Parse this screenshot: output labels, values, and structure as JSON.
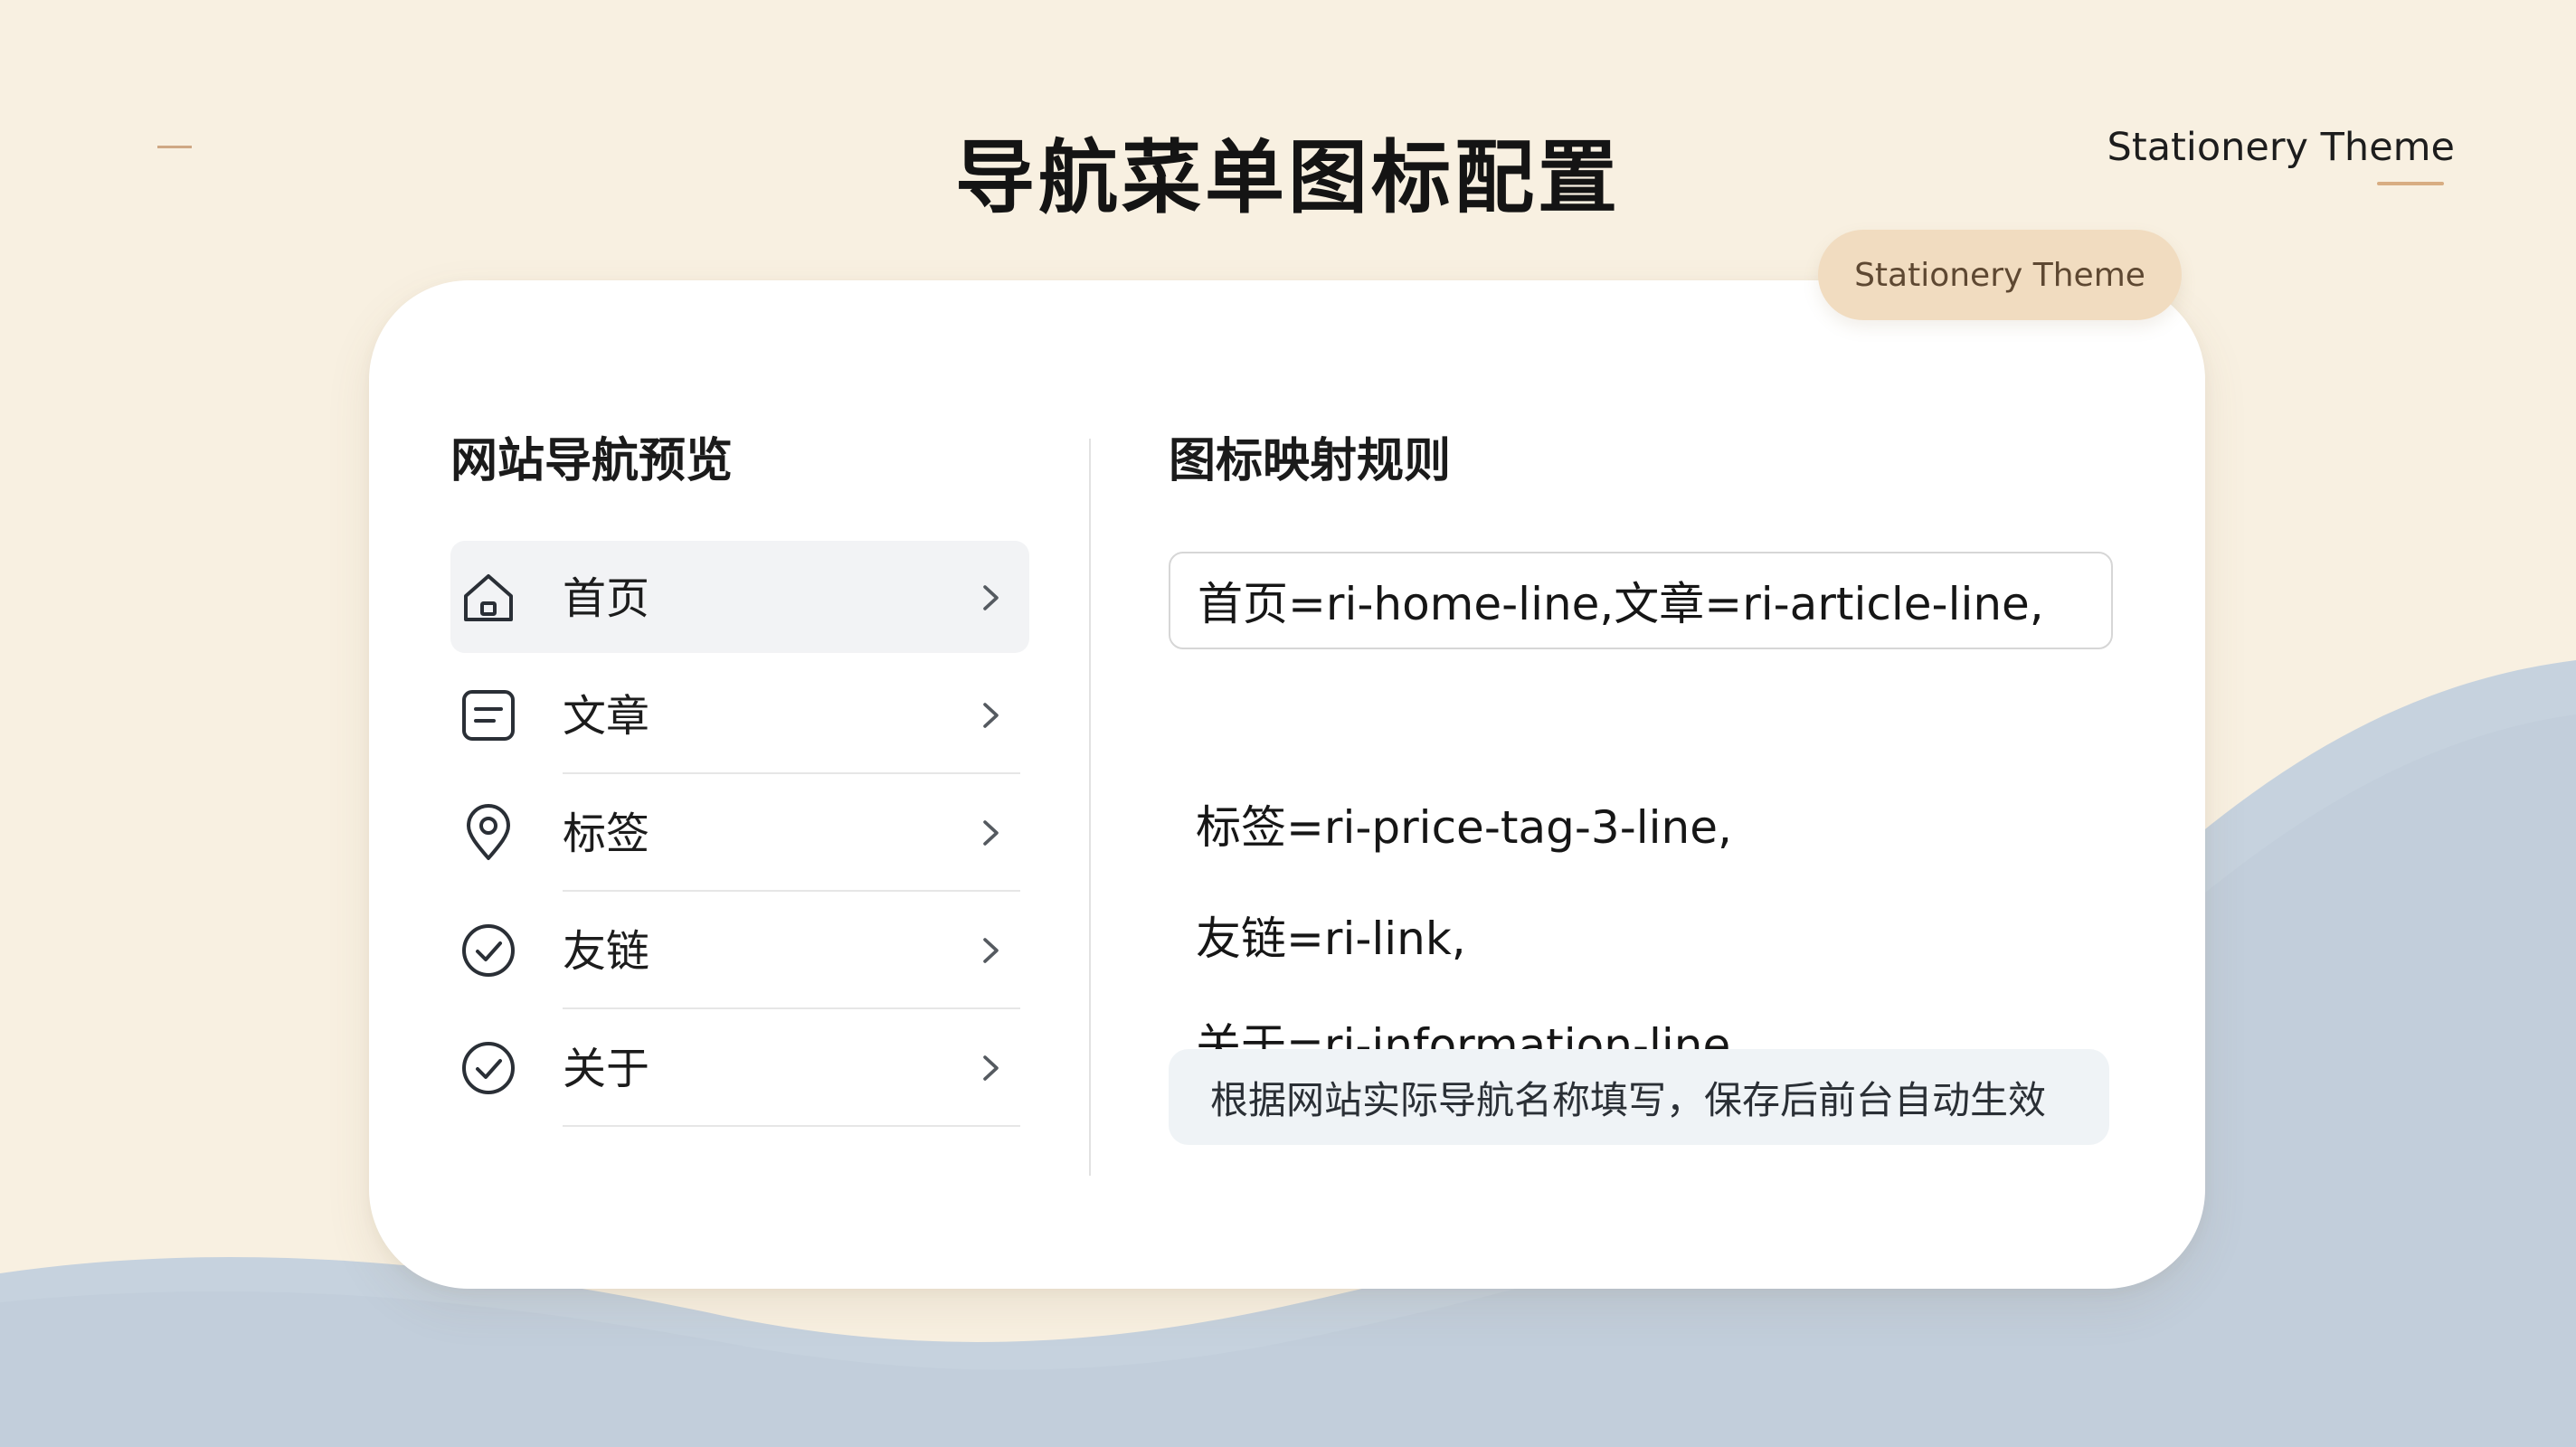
{
  "page": {
    "title": "导航菜单图标配置",
    "brand": "Stationery Theme",
    "badge": "Stationery Theme"
  },
  "preview": {
    "title": "网站导航预览",
    "items": [
      {
        "label": "首页",
        "icon": "home-icon",
        "active": true
      },
      {
        "label": "文章",
        "icon": "article-icon",
        "active": false
      },
      {
        "label": "标签",
        "icon": "location-pin-icon",
        "active": false
      },
      {
        "label": "友链",
        "icon": "check-circle-icon",
        "active": false
      },
      {
        "label": "关于",
        "icon": "check-circle-icon",
        "active": false
      }
    ]
  },
  "mapping": {
    "title": "图标映射规则",
    "input_value": "首页=ri-home-line,文章=ri-article-line,",
    "lines": [
      "标签=ri-price-tag-3-line,",
      "友链=ri-link,",
      "关于=ri-information-line"
    ],
    "note": "根据网站实际导航名称填写，保存后前台自动生效"
  },
  "colors": {
    "background": "#f8f0e1",
    "wave": "#c6d2de",
    "accent": "#d8ad82",
    "badge_bg": "#f1dcc0",
    "card": "#ffffff",
    "active_item": "#f2f3f5"
  }
}
